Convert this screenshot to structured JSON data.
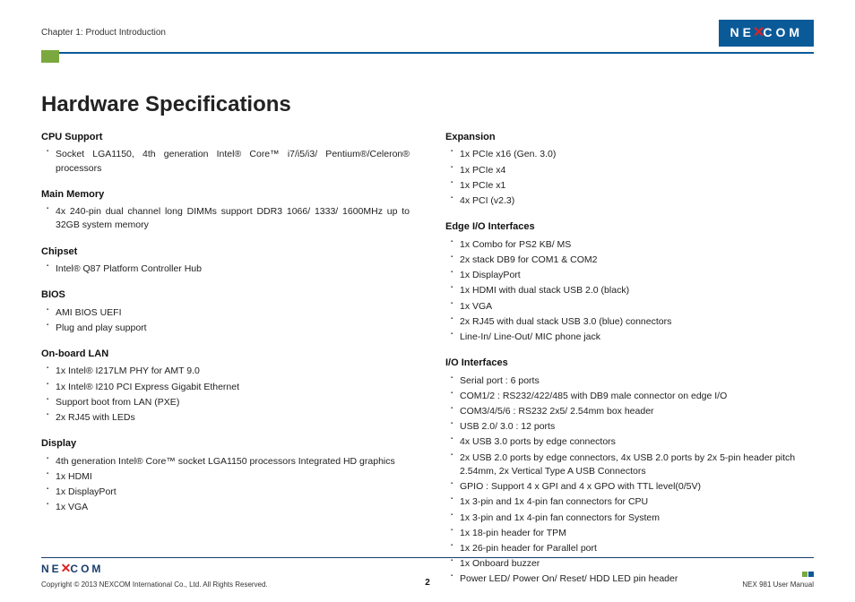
{
  "header": {
    "chapter": "Chapter 1: Product Introduction",
    "brand": "NEXCOM"
  },
  "title": "Hardware Specifications",
  "left": [
    {
      "heading": "CPU Support",
      "items": [
        "Socket LGA1150, 4th generation Intel® Core™ i7/i5/i3/ Pentium®/Celeron® processors"
      ]
    },
    {
      "heading": "Main Memory",
      "items": [
        "4x 240-pin dual channel long DIMMs support DDR3 1066/ 1333/ 1600MHz up to 32GB system memory"
      ]
    },
    {
      "heading": "Chipset",
      "items": [
        "Intel® Q87 Platform Controller Hub"
      ]
    },
    {
      "heading": "BIOS",
      "items": [
        "AMI BIOS UEFI",
        "Plug and play support"
      ]
    },
    {
      "heading": "On-board LAN",
      "items": [
        "1x Intel® I217LM PHY for AMT 9.0",
        "1x Intel® I210 PCI Express Gigabit Ethernet",
        "Support boot from LAN (PXE)",
        "2x RJ45 with LEDs"
      ]
    },
    {
      "heading": "Display",
      "items": [
        "4th generation Intel® Core™ socket LGA1150 processors Integrated HD graphics",
        "1x HDMI",
        "1x DisplayPort",
        "1x VGA"
      ]
    }
  ],
  "right": [
    {
      "heading": "Expansion",
      "items": [
        "1x PCIe x16 (Gen. 3.0)",
        "1x PCIe x4",
        "1x PCIe x1",
        "4x PCI (v2.3)"
      ]
    },
    {
      "heading": "Edge I/O Interfaces",
      "items": [
        "1x Combo for PS2 KB/ MS",
        "2x stack DB9 for COM1 & COM2",
        "1x DisplayPort",
        "1x HDMI with dual stack USB 2.0 (black)",
        "1x VGA",
        "2x RJ45 with dual stack USB 3.0 (blue) connectors",
        "Line-In/ Line-Out/ MIC phone jack"
      ]
    },
    {
      "heading": "I/O Interfaces",
      "items": [
        "Serial port : 6 ports",
        "COM1/2 : RS232/422/485 with DB9 male connector on edge I/O",
        "COM3/4/5/6 : RS232 2x5/ 2.54mm box header",
        "USB 2.0/ 3.0 : 12 ports",
        "4x USB 3.0 ports by edge connectors",
        "2x USB 2.0 ports by edge connectors, 4x USB 2.0 ports by 2x 5-pin header pitch 2.54mm, 2x Vertical Type A USB Connectors",
        "GPIO : Support 4 x GPI and 4 x GPO with TTL level(0/5V)",
        "1x 3-pin and 1x 4-pin fan connectors for CPU",
        "1x 3-pin and 1x 4-pin fan connectors for System",
        "1x 18-pin header for TPM",
        "1x 26-pin header for Parallel port",
        "1x Onboard buzzer",
        "Power LED/ Power On/ Reset/ HDD LED pin header"
      ]
    }
  ],
  "footer": {
    "copyright": "Copyright © 2013 NEXCOM International Co., Ltd. All Rights Reserved.",
    "page": "2",
    "manual": "NEX 981 User Manual"
  }
}
